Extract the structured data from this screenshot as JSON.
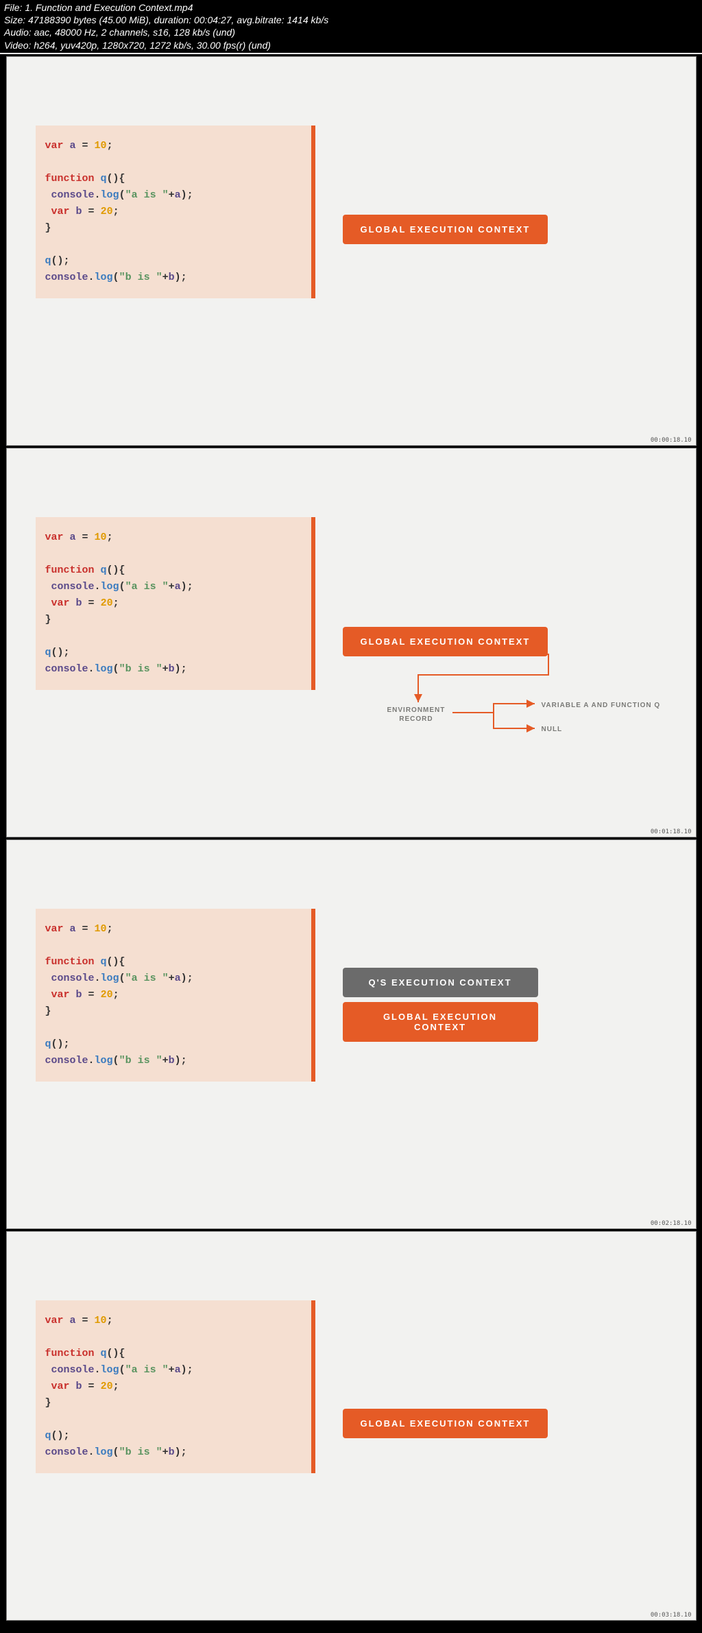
{
  "header": {
    "file": "File: 1. Function and Execution Context.mp4",
    "size": "Size: 47188390 bytes (45.00 MiB), duration: 00:04:27, avg.bitrate: 1414 kb/s",
    "audio": "Audio: aac, 48000 Hz, 2 channels, s16, 128 kb/s (und)",
    "video": "Video: h264, yuv420p, 1280x720, 1272 kb/s, 30.00 fps(r) (und)"
  },
  "code": {
    "l1_kw": "var ",
    "l1_id": "a",
    "l1_pun": " = ",
    "l1_num": "10",
    "l1_end": ";",
    "l3_kw": "function ",
    "l3_fn": "q",
    "l3_pun": "(){",
    "l4_sp": " ",
    "l4_id": "console",
    "l4_dot": ".",
    "l4_fn": "log",
    "l4_p1": "(",
    "l4_str": "\"a is \"",
    "l4_plus": "+",
    "l4_id2": "a",
    "l4_p2": ");",
    "l5_sp": " ",
    "l5_kw": "var ",
    "l5_id": "b",
    "l5_pun": " = ",
    "l5_num": "20",
    "l5_end": ";",
    "l6": "}",
    "l8_fn": "q",
    "l8_pun": "();",
    "l9_id": "console",
    "l9_dot": ".",
    "l9_fn": "log",
    "l9_p1": "(",
    "l9_str": "\"b is \"",
    "l9_plus": "+",
    "l9_id2": "b",
    "l9_p2": ");"
  },
  "labels": {
    "global": "GLOBAL EXECUTION CONTEXT",
    "q_ctx": "Q'S EXECUTION CONTEXT",
    "env_record": "ENVIRONMENT\nRECORD",
    "var_fn": "VARIABLE A AND FUNCTION Q",
    "null": "NULL"
  },
  "frame1_ts": "00:00:18.10",
  "frame2_ts": "00:01:18.10",
  "frame3_ts": "00:02:18.10",
  "frame4_ts": "00:03:18.10"
}
